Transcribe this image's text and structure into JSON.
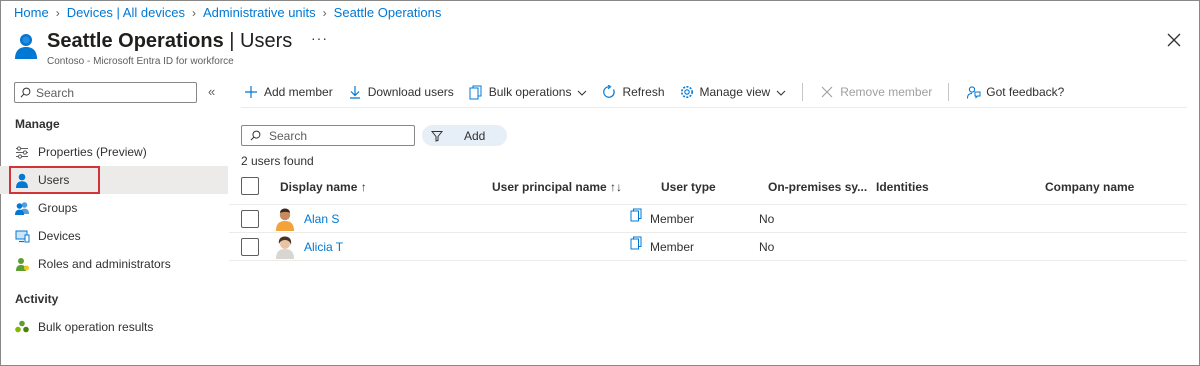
{
  "breadcrumb": {
    "items": [
      "Home",
      "Devices | All devices",
      "Administrative units",
      "Seattle Operations"
    ]
  },
  "header": {
    "title": "Seattle Operations",
    "title_sep": " | ",
    "page": "Users",
    "subtitle": "Contoso - Microsoft Entra ID for workforce",
    "more": "···"
  },
  "sidebar": {
    "search_placeholder": "Search",
    "collapse": "«",
    "sections": [
      {
        "title": "Manage",
        "items": [
          {
            "label": "Properties (Preview)",
            "icon": "settings-sliders-icon"
          },
          {
            "label": "Users",
            "icon": "user-icon",
            "active": true
          },
          {
            "label": "Groups",
            "icon": "groups-icon"
          },
          {
            "label": "Devices",
            "icon": "devices-icon"
          },
          {
            "label": "Roles and administrators",
            "icon": "roles-icon"
          }
        ]
      },
      {
        "title": "Activity",
        "items": [
          {
            "label": "Bulk operation results",
            "icon": "bulk-results-icon"
          }
        ]
      }
    ]
  },
  "toolbar": {
    "add_member": "Add member",
    "download_users": "Download users",
    "bulk_operations": "Bulk operations",
    "refresh": "Refresh",
    "manage_view": "Manage view",
    "remove_member": "Remove member",
    "got_feedback": "Got feedback?"
  },
  "filter": {
    "search_placeholder": "Search",
    "add_filter": "Add"
  },
  "table": {
    "count_text": "2 users found",
    "columns": {
      "display_name": "Display name ↑",
      "upn": "User principal name ↑↓",
      "user_type": "User type",
      "on_prem": "On-premises sy...",
      "identities": "Identities",
      "company": "Company name"
    },
    "rows": [
      {
        "display_name": "Alan S",
        "user_type": "Member",
        "on_prem": "No"
      },
      {
        "display_name": "Alicia T",
        "user_type": "Member",
        "on_prem": "No"
      }
    ]
  },
  "colors": {
    "accent": "#0078d4",
    "highlight_border": "#d13438",
    "active_nav": "#edebe9",
    "filter_pill": "#e6eef7"
  }
}
